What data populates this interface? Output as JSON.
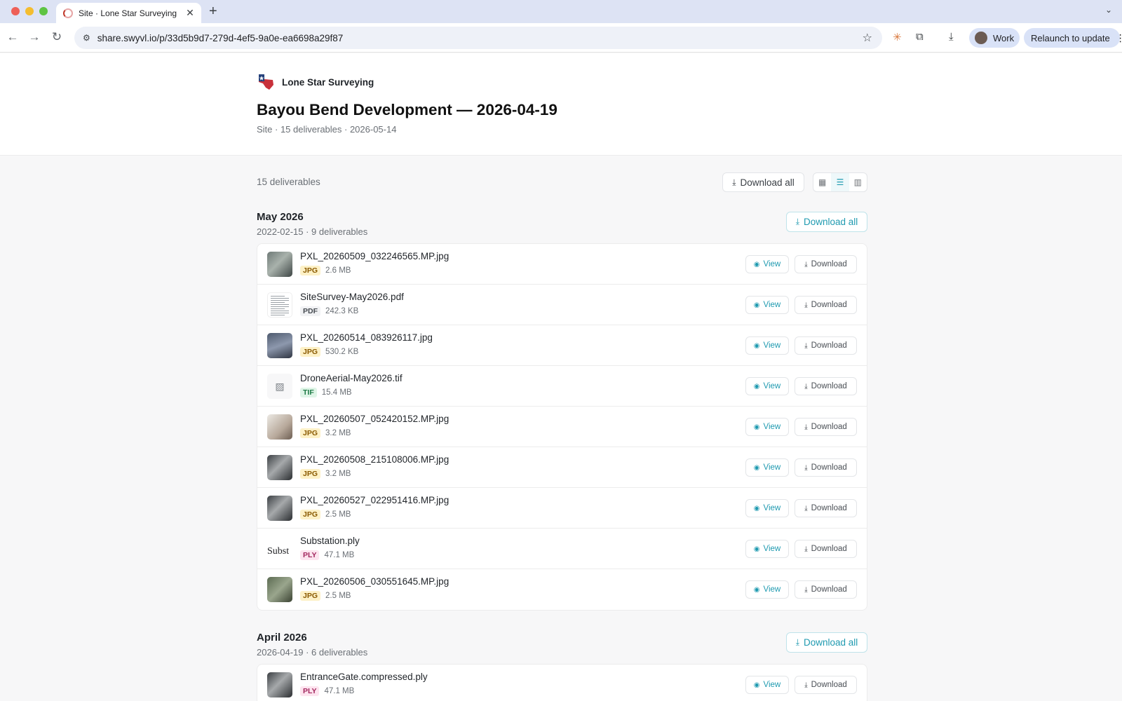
{
  "browser": {
    "tab_title": "Site · Lone Star Surveying",
    "tab_close": "✕",
    "new_tab": "+",
    "url": "share.swyvl.io/p/33d5b9d7-279d-4ef5-9a0e-ea6698a29f87",
    "profile_label": "Work",
    "relaunch_label": "Relaunch to update"
  },
  "header": {
    "brand_name": "Lone Star Surveying",
    "title": "Bayou Bend Development — 2026-04-19",
    "subtitle": "Site · 15 deliverables · 2026-05-14"
  },
  "summary": {
    "count_label": "15 deliverables",
    "download_all_label": "Download all",
    "active_view": "list"
  },
  "labels": {
    "view": "View",
    "download": "Download",
    "download_all": "Download all"
  },
  "groups": [
    {
      "title": "May 2026",
      "subtitle": "2022-02-15 · 9 deliverables",
      "items": [
        {
          "name": "PXL_20260509_032246565.MP.jpg",
          "type": "JPG",
          "size": "2.6 MB",
          "thumb": "photo"
        },
        {
          "name": "SiteSurvey-May2026.pdf",
          "type": "PDF",
          "size": "242.3 KB",
          "thumb": "doc"
        },
        {
          "name": "PXL_20260514_083926117.jpg",
          "type": "JPG",
          "size": "530.2 KB",
          "thumb": "photo2"
        },
        {
          "name": "DroneAerial-May2026.tif",
          "type": "TIF",
          "size": "15.4 MB",
          "thumb": "tif"
        },
        {
          "name": "PXL_20260507_052420152.MP.jpg",
          "type": "JPG",
          "size": "3.2 MB",
          "thumb": "photo3"
        },
        {
          "name": "PXL_20260508_215108006.MP.jpg",
          "type": "JPG",
          "size": "3.2 MB",
          "thumb": "photo5"
        },
        {
          "name": "PXL_20260527_022951416.MP.jpg",
          "type": "JPG",
          "size": "2.5 MB",
          "thumb": "photo5"
        },
        {
          "name": "Substation.ply",
          "type": "PLY",
          "size": "47.1 MB",
          "thumb": "broken",
          "alt": "Subst"
        },
        {
          "name": "PXL_20260506_030551645.MP.jpg",
          "type": "JPG",
          "size": "2.5 MB",
          "thumb": "photo4"
        }
      ]
    },
    {
      "title": "April 2026",
      "subtitle": "2026-04-19 · 6 deliverables",
      "items": [
        {
          "name": "EntranceGate.compressed.ply",
          "type": "PLY",
          "size": "47.1 MB",
          "thumb": "photo5"
        }
      ]
    }
  ],
  "colors": {
    "accent": "#1f9ab0",
    "jpg_badge": "#fdf1c7",
    "pdf_badge": "#f1f2f4",
    "tif_badge": "#dff5e7",
    "ply_badge": "#fde4ef"
  }
}
